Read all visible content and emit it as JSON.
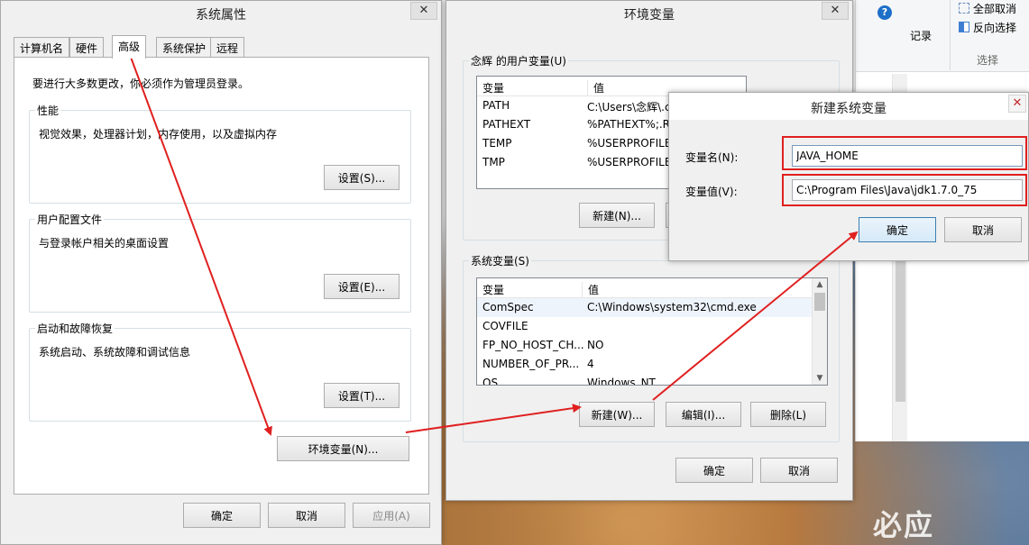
{
  "sysprops": {
    "title": "系统属性",
    "close": "✕",
    "tabs": [
      "计算机名",
      "硬件",
      "高级",
      "系统保护",
      "远程"
    ],
    "admin_note": "要进行大多数更改，你必须作为管理员登录。",
    "perf": {
      "label": "性能",
      "desc": "视觉效果，处理器计划，内存使用，以及虚拟内存",
      "button": "设置(S)..."
    },
    "profile": {
      "label": "用户配置文件",
      "desc": "与登录帐户相关的桌面设置",
      "button": "设置(E)..."
    },
    "startup": {
      "label": "启动和故障恢复",
      "desc": "系统启动、系统故障和调试信息",
      "button": "设置(T)..."
    },
    "env_button": "环境变量(N)...",
    "ok": "确定",
    "cancel": "取消",
    "apply": "应用(A)"
  },
  "envvars": {
    "title": "环境变量",
    "close": "✕",
    "user_group": "念辉 的用户变量(U)",
    "col_var": "变量",
    "col_val": "值",
    "user_rows": [
      {
        "name": "PATH",
        "value": "C:\\Users\\念辉\\.c"
      },
      {
        "name": "PATHEXT",
        "value": "%PATHEXT%;.R"
      },
      {
        "name": "TEMP",
        "value": "%USERPROFILE"
      },
      {
        "name": "TMP",
        "value": "%USERPROFILE"
      }
    ],
    "user_new": "新建(N)...",
    "sys_group": "系统变量(S)",
    "sys_rows": [
      {
        "name": "ComSpec",
        "value": "C:\\Windows\\system32\\cmd.exe"
      },
      {
        "name": "COVFILE",
        "value": ""
      },
      {
        "name": "FP_NO_HOST_CH...",
        "value": "NO"
      },
      {
        "name": "NUMBER_OF_PR...",
        "value": "4"
      },
      {
        "name": "OS",
        "value": "Windows_NT"
      }
    ],
    "sys_new": "新建(W)...",
    "sys_edit": "编辑(I)...",
    "sys_delete": "删除(L)",
    "ok": "确定",
    "cancel": "取消"
  },
  "newvar": {
    "title": "新建系统变量",
    "close": "✕",
    "name_label": "变量名(N):",
    "name_value": "JAVA_HOME",
    "value_label": "变量值(V):",
    "value_value": "C:\\Program Files\\Java\\jdk1.7.0_75",
    "ok": "确定",
    "cancel": "取消"
  },
  "ribbon": {
    "help": "?",
    "history": "记录",
    "select_none": "全部取消",
    "invert": "反向选择",
    "group": "选择"
  },
  "watermark": "必应",
  "colors": {
    "annotation": "#e02020",
    "accent": "#3c7fb1"
  }
}
